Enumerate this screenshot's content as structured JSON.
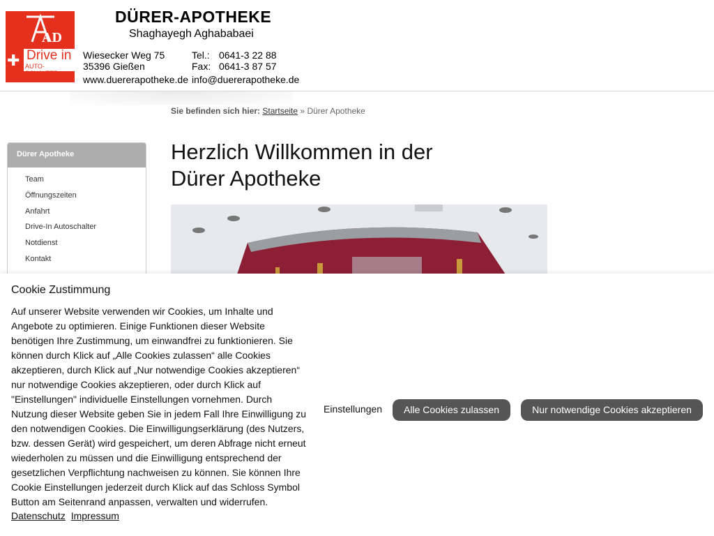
{
  "header": {
    "brand": "DÜRER-APOTHEKE",
    "owner": "Shaghayegh Aghababaei",
    "logo_letters": "AD",
    "drive_label": "Drive in",
    "drive_sub": "AUTO-SCHALTER",
    "street": "Wiesecker Weg 75",
    "city": "35396 Gießen",
    "web": "www.duererapotheke.de",
    "tel_label": "Tel.:",
    "tel": "0641-3 22 88",
    "fax_label": "Fax:",
    "fax": "0641-3 87 57",
    "email": "info@duererapotheke.de",
    "accent_color": "#e4301c"
  },
  "breadcrumb": {
    "prefix": "Sie befinden sich hier:",
    "home": "Startseite",
    "sep": "»",
    "current": "Dürer Apotheke"
  },
  "sidebar": {
    "title": "Dürer Apotheke",
    "items": [
      "Team",
      "Öffnungszeiten",
      "Anfahrt",
      "Drive-In Autoschalter",
      "Notdienst",
      "Kontakt"
    ]
  },
  "main": {
    "title_line1": "Herzlich Willkommen in der",
    "title_line2": "Dürer Apotheke"
  },
  "cookie": {
    "title": "Cookie Zustimmung",
    "text": "Auf unserer Website verwenden wir Cookies, um Inhalte und Angebote zu optimieren. Einige Funktionen dieser Website benötigen Ihre Zustimmung, um einwandfrei zu funktionieren. Sie können durch Klick auf „Alle Cookies zulassen“ alle Cookies akzeptieren, durch Klick auf „Nur notwendige Cookies akzeptieren“ nur notwendige Cookies akzeptieren, oder durch Klick auf \"Einstellungen\" individuelle Einstellungen vornehmen. Durch Nutzung dieser Website geben Sie in jedem Fall Ihre Einwilligung zu den notwendigen Cookies. Die Einwilligungserklärung (des Nutzers, bzw. dessen Gerät) wird gespeichert, um deren Abfrage nicht erneut wiederholen zu müssen und die Einwilligung entsprechend der gesetzlichen Verpflichtung nachweisen zu können. Sie können Ihre Cookie Einstellungen jederzeit durch Klick auf das Schloss Symbol Button am Seitenrand anpassen, verwalten und widerrufen.",
    "link_privacy": "Datenschutz",
    "link_imprint": "Impressum",
    "settings": "Einstellungen",
    "accept_all": "Alle Cookies zulassen",
    "accept_necessary": "Nur notwendige Cookies akzeptieren"
  }
}
